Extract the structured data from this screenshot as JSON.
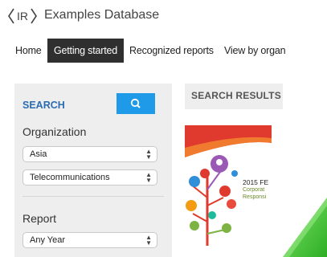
{
  "header": {
    "logo_text": "IR",
    "title": "Examples Database"
  },
  "nav": {
    "items": [
      {
        "label": "Home",
        "active": false
      },
      {
        "label": "Getting started",
        "active": true
      },
      {
        "label": "Recognized reports",
        "active": false
      },
      {
        "label": "View by organ",
        "active": false
      }
    ]
  },
  "sidebar": {
    "search_label": "SEARCH",
    "search_button_icon": "search-icon",
    "organization": {
      "heading": "Organization",
      "region_value": "Asia",
      "sector_value": "Telecommunications"
    },
    "report": {
      "heading": "Report",
      "year_value": "Any Year"
    }
  },
  "results": {
    "tab_label": "SEARCH RESULTS",
    "thumbnail": {
      "line1": "2015 FE",
      "line2": "Corporat",
      "line3": "Responsi"
    }
  },
  "colors": {
    "accent_blue": "#1e9ae8",
    "nav_active_bg": "#2f2f2f",
    "panel_bg": "#eeeeee",
    "corner_green": "#3cbf2a"
  }
}
